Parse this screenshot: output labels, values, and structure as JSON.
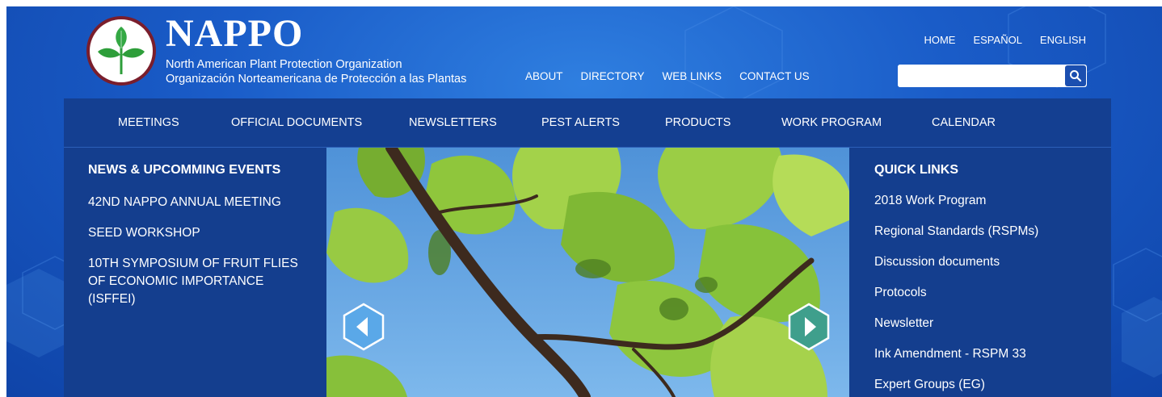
{
  "brand": {
    "name": "NAPPO",
    "subtitle_en": "North American Plant Protection Organization",
    "subtitle_es": "Organización Norteamericana de Protección a las Plantas",
    "colors": {
      "ring": "#7a1e2c",
      "leaf": "#2e9e3a",
      "nav_bg": "#143f91",
      "page_bg": "#1a5cc8"
    }
  },
  "utility_nav": [
    "HOME",
    "ESPAÑOL",
    "ENGLISH"
  ],
  "top_links": [
    "ABOUT",
    "DIRECTORY",
    "WEB LINKS",
    "CONTACT US"
  ],
  "search": {
    "placeholder": "",
    "value": "",
    "icon": "search-icon"
  },
  "main_nav": [
    "MEETINGS",
    "OFFICIAL DOCUMENTS",
    "NEWSLETTERS",
    "PEST ALERTS",
    "PRODUCTS",
    "WORK PROGRAM",
    "CALENDAR"
  ],
  "news": {
    "heading": "NEWS & UPCOMMING EVENTS",
    "items": [
      "42ND NAPPO ANNUAL MEETING",
      "SEED WORKSHOP",
      "10TH SYMPOSIUM OF FRUIT FLIES OF ECONOMIC IMPORTANCE (ISFFEI)"
    ]
  },
  "slider": {
    "prev_icon": "chevron-left-icon",
    "next_icon": "chevron-right-icon"
  },
  "quick_links": {
    "heading": "QUICK LINKS",
    "items": [
      "2018 Work Program",
      "Regional Standards (RSPMs)",
      "Discussion documents",
      "Protocols",
      "Newsletter",
      "Ink Amendment - RSPM 33",
      "Expert Groups (EG)"
    ]
  }
}
